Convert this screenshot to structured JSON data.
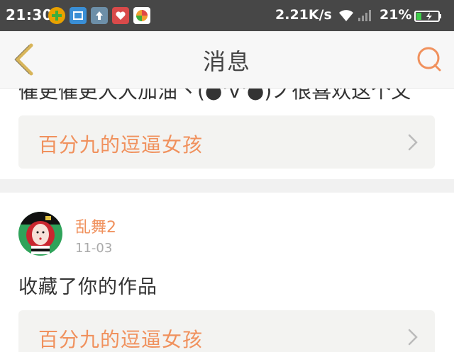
{
  "status_bar": {
    "time": "21:30",
    "net_speed": "2.21K/s",
    "battery": "21%",
    "app_icons": [
      "plus-app-icon",
      "screen-capture-icon",
      "upload-arrow-icon",
      "heart-app-icon",
      "game-center-icon"
    ]
  },
  "header": {
    "title": "消息"
  },
  "feed": {
    "partial_message": "催更催更大大加油丶(●'∀'●)ノ很喜欢这个文",
    "items": [
      {
        "work_title": "百分九的逗逼女孩"
      },
      {
        "user": "乱舞2",
        "date": "11-03",
        "action": "收藏了你的作品",
        "work_title": "百分九的逗逼女孩"
      }
    ]
  },
  "colors": {
    "accent": "#f0915d",
    "status_bar_bg": "#474747",
    "header_bg": "#f7f7f7",
    "back_arrow": "#d8b55a"
  }
}
